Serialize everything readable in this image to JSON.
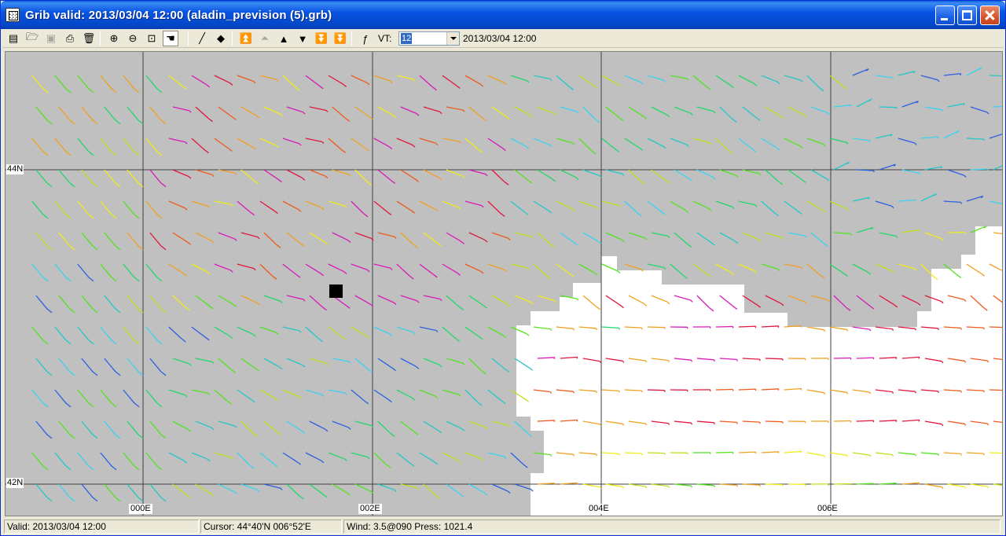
{
  "window": {
    "title": "Grib valid: 2013/03/04 12:00 (aladin_prevision (5).grb)"
  },
  "toolbar": {
    "tools": [
      {
        "name": "new-icon",
        "glyph": "▤"
      },
      {
        "name": "open-folder-icon",
        "glyph": "🗁"
      },
      {
        "name": "save-icon",
        "glyph": "▣",
        "disabled": true
      },
      {
        "name": "print-icon",
        "glyph": "⎙"
      },
      {
        "name": "delete-icon",
        "glyph": "🗑"
      },
      {
        "name": "zoom-in-icon",
        "glyph": "⊕"
      },
      {
        "name": "zoom-out-icon",
        "glyph": "⊖"
      },
      {
        "name": "zoom-fit-icon",
        "glyph": "⊡"
      },
      {
        "name": "hand-pan-icon",
        "glyph": "☚",
        "pressed": true
      },
      {
        "name": "draw-line-icon",
        "glyph": "╱"
      },
      {
        "name": "point-icon",
        "glyph": "◆"
      },
      {
        "name": "first-step-icon",
        "glyph": "⏫"
      },
      {
        "name": "prev-fast-icon",
        "glyph": "⏶",
        "disabled": true
      },
      {
        "name": "prev-step-icon",
        "glyph": "▲"
      },
      {
        "name": "next-step-icon",
        "glyph": "▼"
      },
      {
        "name": "next-fast-icon",
        "glyph": "⏬"
      },
      {
        "name": "last-step-icon",
        "glyph": "⏬"
      },
      {
        "name": "function-icon",
        "glyph": "ƒ"
      }
    ],
    "vt_label": "VT:",
    "vt_value": "12",
    "vt_date": "2013/03/04 12:00"
  },
  "map": {
    "lat_labels": [
      "44N",
      "42N"
    ],
    "lon_labels": [
      "000E",
      "002E",
      "004E",
      "006E"
    ],
    "land_color": "#ffffff",
    "sea_color": "#c0c0c0",
    "wind_colors": [
      "#3ad2f0",
      "#22c7c7",
      "#1fd86b",
      "#52e31f",
      "#b8e31a",
      "#f0ec18",
      "#f0a020",
      "#ee5a1a",
      "#e0163c",
      "#d81ab8",
      "#2c5fe0"
    ]
  },
  "status": {
    "valid": "Valid: 2013/03/04 12:00",
    "cursor": "Cursor: 44°40'N  006°52'E",
    "wind": "Wind:  3.5@090  Press: 1021.4"
  }
}
